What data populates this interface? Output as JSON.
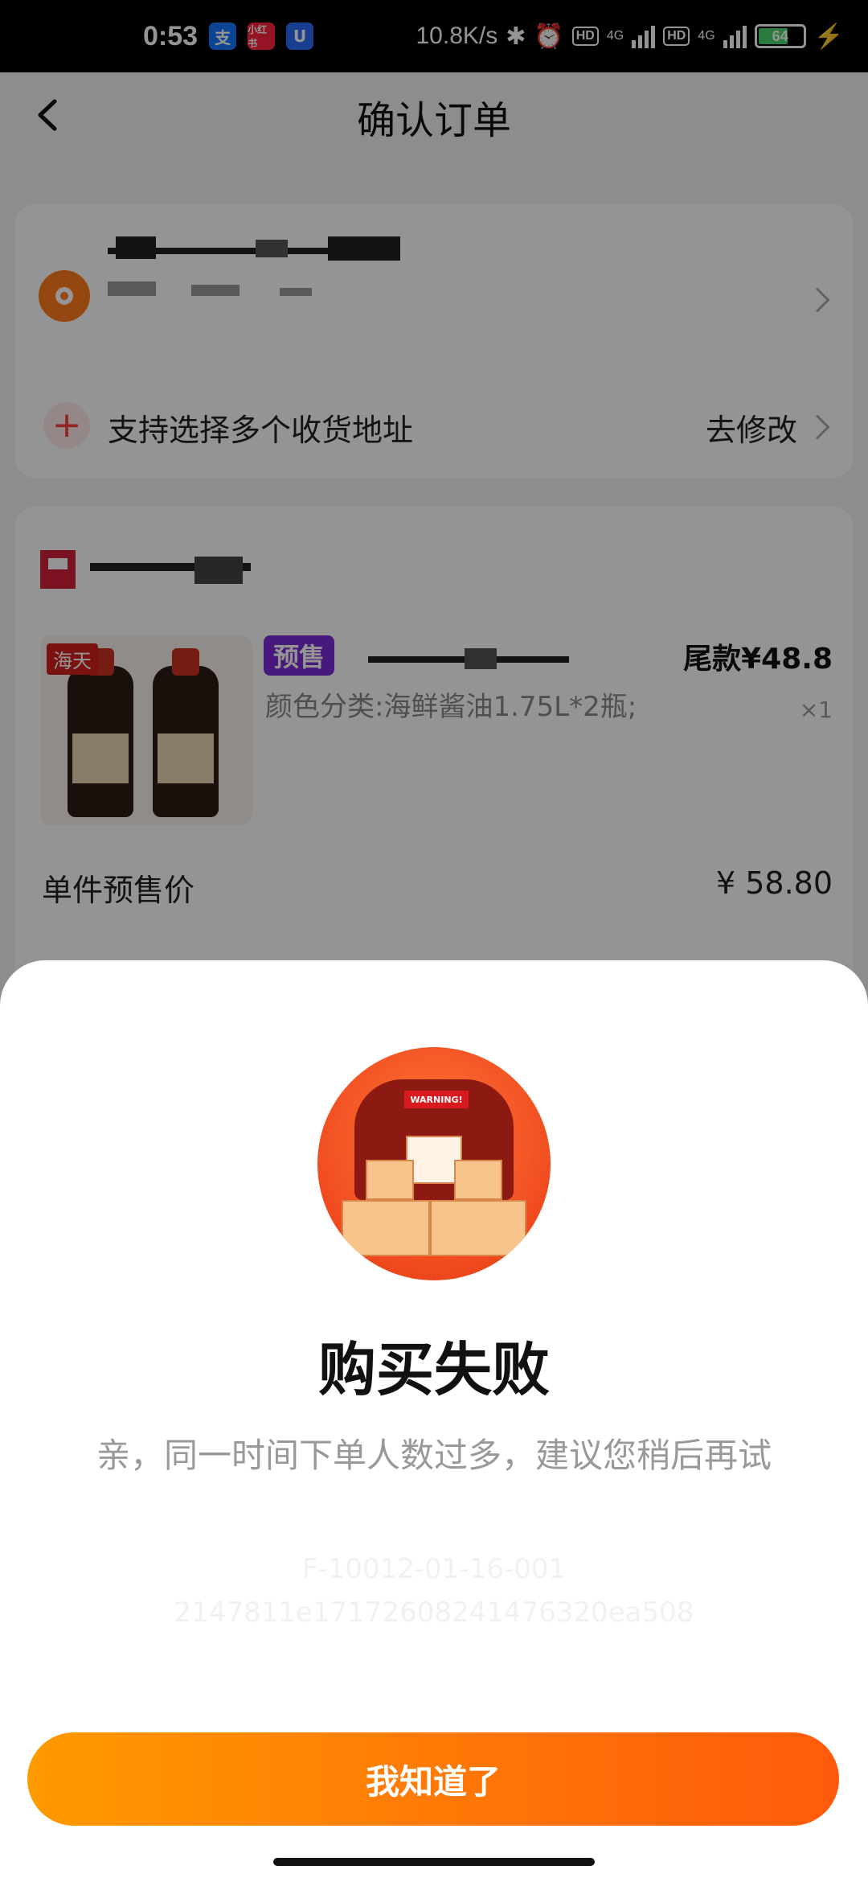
{
  "status_bar": {
    "time": "0:53",
    "apps": [
      {
        "label": "支",
        "color": "#1677ff"
      },
      {
        "label": "小红书",
        "color": "#ff2442"
      },
      {
        "label": "U",
        "color": "#2b6cf6"
      }
    ],
    "speed": "10.8K/s",
    "net1": "4G",
    "net2": "4G",
    "hd": "HD",
    "battery": "64"
  },
  "header": {
    "title": "确认订单"
  },
  "address": {
    "multi_label": "支持选择多个收货地址",
    "edit_label": "去修改"
  },
  "order": {
    "brand_tag": "海天",
    "presale_badge": "预售",
    "final_price": "尾款¥48.8",
    "variant": "颜色分类:海鲜酱油1.75L*2瓶;",
    "quantity": "×1",
    "unit_label": "单件预售价",
    "unit_price": "¥ 58.80"
  },
  "dialog": {
    "illustration_sign": "WARNING!",
    "title": "购买失败",
    "message": "亲，同一时间下单人数过多，建议您稍后再试",
    "code_line1": "F-10012-01-16-001",
    "code_line2": "2147811e17172608241476320ea508",
    "confirm_label": "我知道了"
  },
  "colors": {
    "accent_start": "#ff9a00",
    "accent_end": "#ff5a0c",
    "presale": "#7b2cd6"
  }
}
